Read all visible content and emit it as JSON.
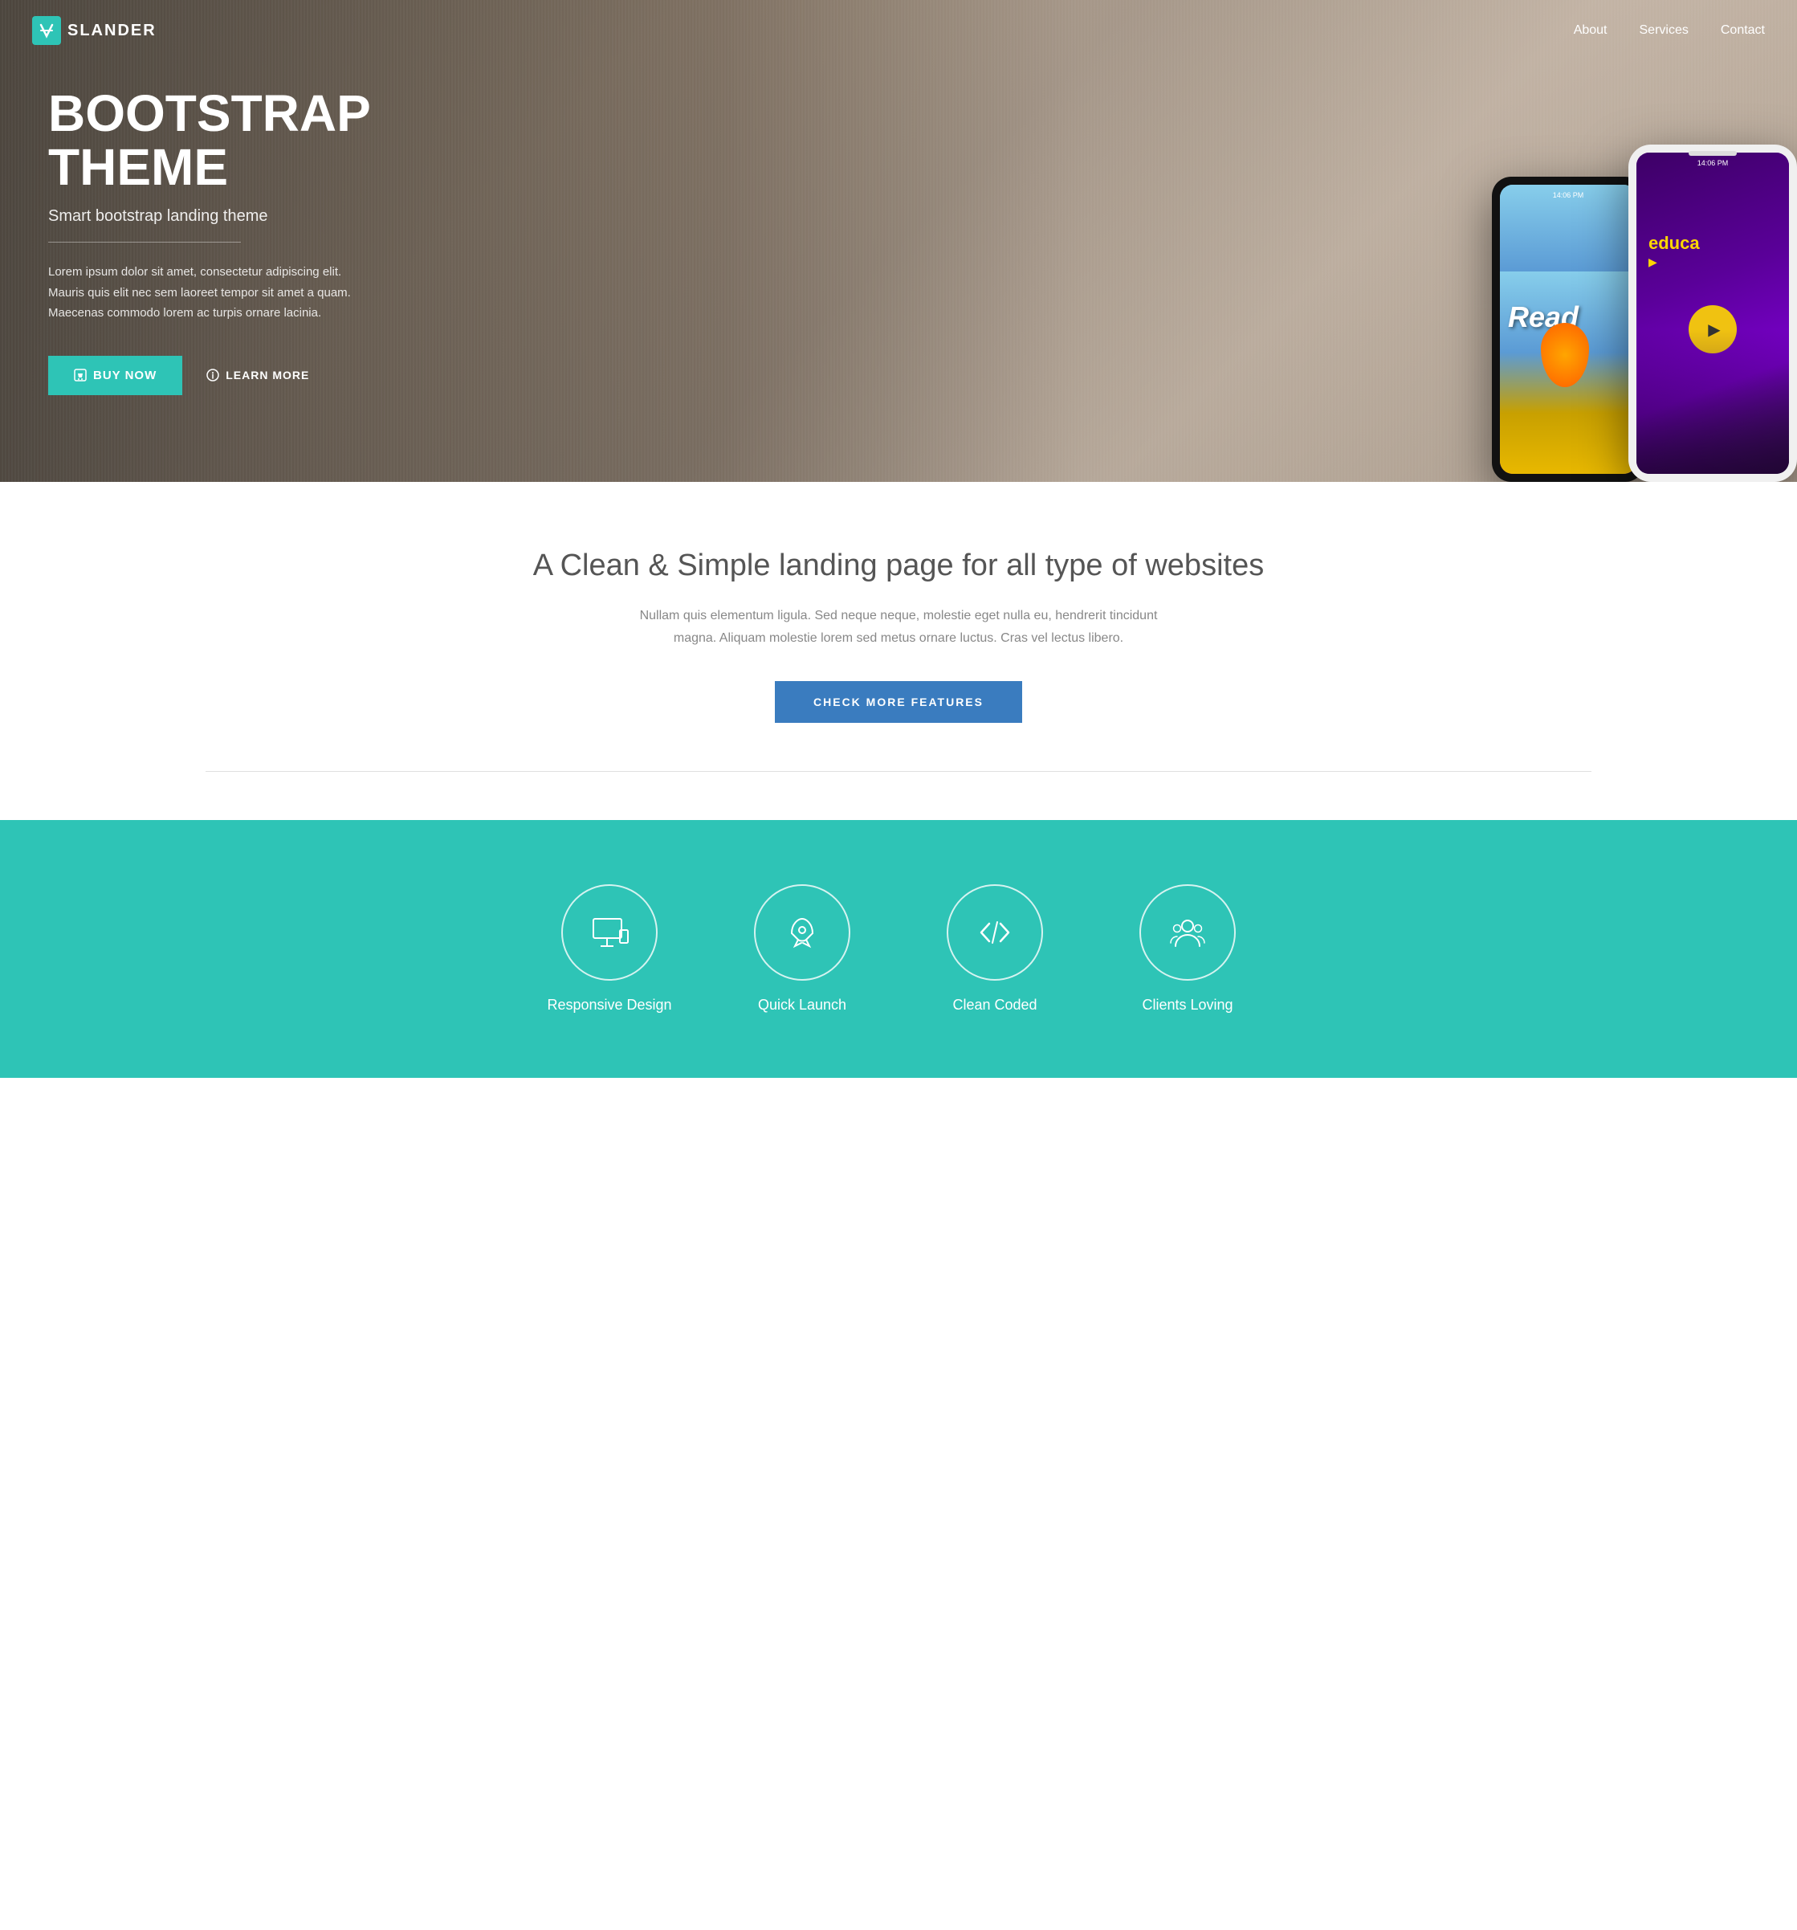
{
  "nav": {
    "logo_text": "SLANDER",
    "links": [
      {
        "label": "About",
        "href": "#about"
      },
      {
        "label": "Services",
        "href": "#services"
      },
      {
        "label": "Contact",
        "href": "#contact"
      }
    ]
  },
  "hero": {
    "title": "BOOTSTRAP THEME",
    "subtitle": "Smart bootstrap landing theme",
    "description": "Lorem ipsum dolor sit amet, consectetur adipiscing elit. Mauris quis elit nec sem laoreet tempor sit amet a quam. Maecenas commodo lorem ac turpis ornare lacinia.",
    "buy_label": "BUY NOW",
    "learn_label": "LEARN MORE",
    "phone_black_time": "14:06 PM",
    "phone_white_time": "14:06 PM",
    "phone_black_app": "Read",
    "phone_white_app": "educa"
  },
  "middle": {
    "title": "A Clean & Simple landing page for all type of websites",
    "description": "Nullam quis elementum ligula. Sed neque neque, molestie eget nulla eu, hendrerit tincidunt magna. Aliquam molestie lorem sed metus ornare luctus. Cras vel lectus libero.",
    "cta_label": "CHECK MORE FEATURES"
  },
  "features": {
    "items": [
      {
        "label": "Responsive Design",
        "icon": "monitor-icon"
      },
      {
        "label": "Quick Launch",
        "icon": "rocket-icon"
      },
      {
        "label": "Clean Coded",
        "icon": "code-icon"
      },
      {
        "label": "Clients Loving",
        "icon": "users-icon"
      }
    ]
  }
}
